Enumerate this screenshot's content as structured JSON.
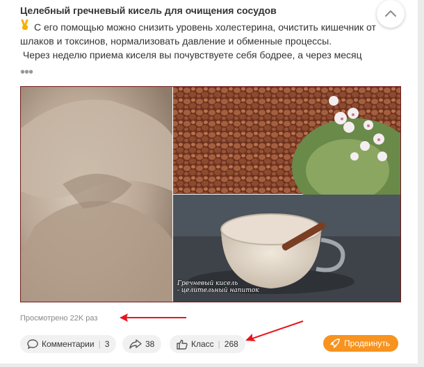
{
  "post": {
    "title": "Целебный гречневый кисель для очищения сосудов",
    "emoji_icon": "victory-hand-icon",
    "paragraph1": "С его помощью можно снизить уровень холестерина, очистить кишечник от шлаков и токсинов, нормализовать давление и обменные процессы.",
    "paragraph2": "Через неделю приема киселя вы почувствуете себя бодрее, а через месяц",
    "more": "•••",
    "collapse_icon": "chevron-up-icon",
    "image_caption_line1": "Гречневый кисель",
    "image_caption_line2": "- целительный напиток"
  },
  "stats": {
    "views": "Просмотрено 22K раз"
  },
  "actions": {
    "comments_label": "Комментарии",
    "comments_count": "3",
    "reshare_count": "38",
    "like_label": "Класс",
    "like_count": "268",
    "promote_label": "Продвинуть"
  },
  "colors": {
    "annotation_arrow": "#e8141c",
    "promote_button": "#f7931e"
  }
}
